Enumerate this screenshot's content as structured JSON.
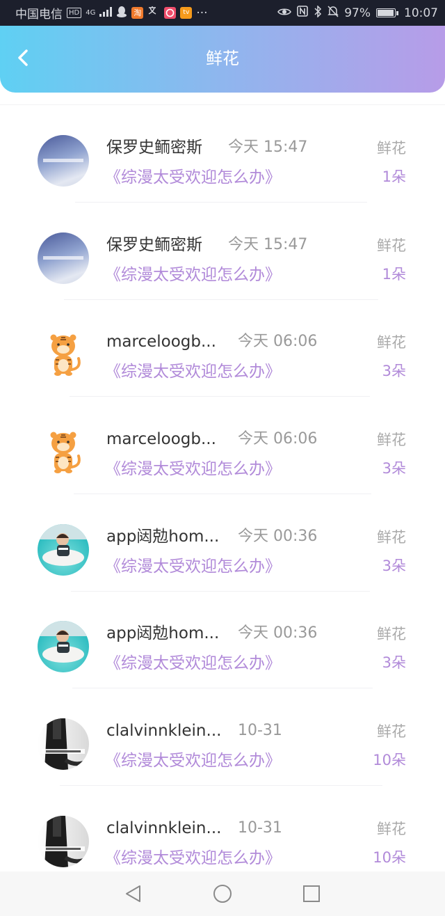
{
  "status_bar": {
    "carrier": "中国电信",
    "hd": "HD",
    "net": "4G",
    "app_taobao": "淘",
    "app_tv": "tv",
    "more": "···",
    "battery": "97%",
    "battery_level": 0.97,
    "time": "10:07"
  },
  "header": {
    "title": "鲜花",
    "accent_left": "#5fd0f3",
    "accent_right": "#b79ce8"
  },
  "list": {
    "items": [
      {
        "name": "保罗史鲕密斯",
        "time": "今天 15:47",
        "book": "《综漫太受欢迎怎么办》",
        "type": "鲜花",
        "count": "1朵"
      },
      {
        "name": "保罗史鲕密斯",
        "time": "今天 15:47",
        "book": "《综漫太受欢迎怎么办》",
        "type": "鲜花",
        "count": "1朵"
      },
      {
        "name": "marceloogb...",
        "time": "今天 06:06",
        "book": "《综漫太受欢迎怎么办》",
        "type": "鲜花",
        "count": "3朵"
      },
      {
        "name": "marceloogb...",
        "time": "今天 06:06",
        "book": "《综漫太受欢迎怎么办》",
        "type": "鲜花",
        "count": "3朵"
      },
      {
        "name": "app闼勊hom...",
        "time": "今天 00:36",
        "book": "《综漫太受欢迎怎么办》",
        "type": "鲜花",
        "count": "3朵"
      },
      {
        "name": "app闼勊hom...",
        "time": "今天 00:36",
        "book": "《综漫太受欢迎怎么办》",
        "type": "鲜花",
        "count": "3朵"
      },
      {
        "name": "clalvinnklein...",
        "time": "10-31",
        "book": "《综漫太受欢迎怎么办》",
        "type": "鲜花",
        "count": "10朵"
      },
      {
        "name": "clalvinnklein...",
        "time": "10-31",
        "book": "《综漫太受欢迎怎么办》",
        "type": "鲜花",
        "count": "10朵"
      }
    ]
  },
  "colors": {
    "accent_purple": "#b18ad9",
    "name_text": "#333333",
    "muted_text": "#999999"
  }
}
